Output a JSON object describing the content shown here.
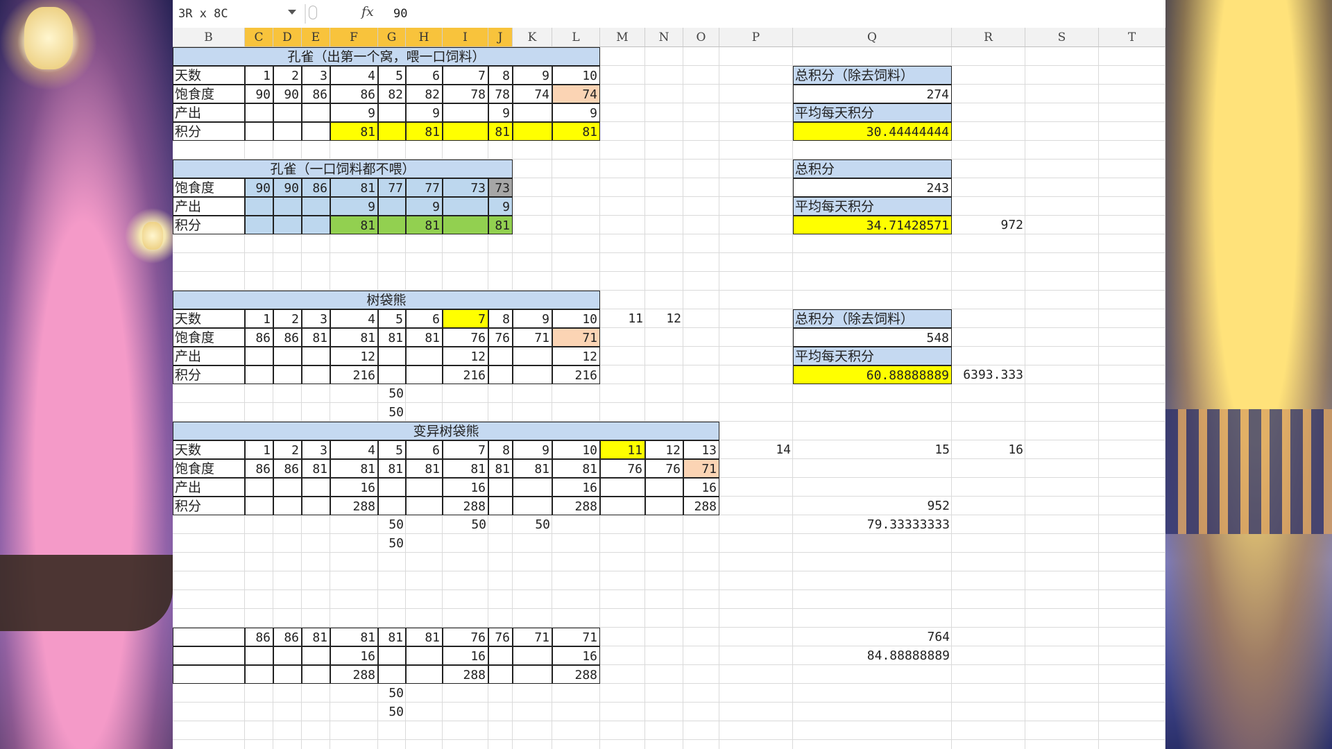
{
  "formula_bar": {
    "name_box": "3R x 8C",
    "fx_symbol": "fx",
    "value": "90"
  },
  "columns": [
    "B",
    "C",
    "D",
    "E",
    "F",
    "G",
    "H",
    "I",
    "J",
    "K",
    "L",
    "M",
    "N",
    "O",
    "P",
    "Q",
    "R",
    "S",
    "T"
  ],
  "selected_columns": [
    "C",
    "D",
    "E",
    "F",
    "G",
    "H",
    "I",
    "J"
  ],
  "peacock_fed": {
    "title": "孔雀（出第一个窝，喂一口饲料）",
    "labels": [
      "天数",
      "饱食度",
      "产出",
      "积分"
    ],
    "days": [
      "1",
      "2",
      "3",
      "4",
      "5",
      "6",
      "7",
      "8",
      "9",
      "10"
    ],
    "satiety": [
      "90",
      "90",
      "86",
      "86",
      "82",
      "82",
      "78",
      "78",
      "74",
      "74"
    ],
    "output": [
      "",
      "",
      "",
      "9",
      "",
      "9",
      "",
      "9",
      "",
      "9"
    ],
    "score": [
      "",
      "",
      "",
      "81",
      "",
      "81",
      "",
      "81",
      "",
      "81"
    ],
    "summary": {
      "total_label": "总积分（除去饲料）",
      "total": "274",
      "avg_label": "平均每天积分",
      "avg": "30.44444444"
    }
  },
  "peacock_unfed": {
    "title": "孔雀（一口饲料都不喂）",
    "labels": [
      "饱食度",
      "产出",
      "积分"
    ],
    "satiety": [
      "90",
      "90",
      "86",
      "81",
      "77",
      "77",
      "73",
      "73"
    ],
    "output": [
      "",
      "",
      "",
      "9",
      "",
      "9",
      "",
      "9"
    ],
    "score": [
      "",
      "",
      "",
      "81",
      "",
      "81",
      "",
      "81"
    ],
    "summary": {
      "total_label": "总积分",
      "total": "243",
      "avg_label": "平均每天积分",
      "avg": "34.71428571",
      "extra": "972"
    }
  },
  "koala": {
    "title": "树袋熊",
    "labels": [
      "天数",
      "饱食度",
      "产出",
      "积分"
    ],
    "days": [
      "1",
      "2",
      "3",
      "4",
      "5",
      "6",
      "7",
      "8",
      "9",
      "10",
      "11",
      "12"
    ],
    "satiety": [
      "86",
      "86",
      "81",
      "81",
      "81",
      "81",
      "76",
      "76",
      "71",
      "71"
    ],
    "output": [
      "",
      "",
      "",
      "12",
      "",
      "",
      "12",
      "",
      "",
      "12"
    ],
    "score": [
      "",
      "",
      "",
      "216",
      "",
      "",
      "216",
      "",
      "",
      "216"
    ],
    "feed": [
      "50",
      "50"
    ],
    "summary": {
      "total_label": "总积分（除去饲料）",
      "total": "548",
      "avg_label": "平均每天积分",
      "avg": "60.88888889",
      "extra": "6393.333"
    }
  },
  "mutant_koala": {
    "title": "变异树袋熊",
    "labels": [
      "天数",
      "饱食度",
      "产出",
      "积分"
    ],
    "days": [
      "1",
      "2",
      "3",
      "4",
      "5",
      "6",
      "7",
      "8",
      "9",
      "10",
      "11",
      "12",
      "13",
      "14",
      "15",
      "16"
    ],
    "satiety": [
      "86",
      "86",
      "81",
      "81",
      "81",
      "81",
      "81",
      "81",
      "81",
      "81",
      "76",
      "76",
      "71"
    ],
    "output": [
      "",
      "",
      "",
      "16",
      "",
      "",
      "16",
      "",
      "",
      "16",
      "",
      "",
      "16"
    ],
    "score": [
      "",
      "",
      "",
      "288",
      "",
      "",
      "288",
      "",
      "",
      "288",
      "",
      "",
      "288"
    ],
    "feed": [
      "50",
      "50",
      "50"
    ],
    "feed2": "50",
    "summary": {
      "total": "952",
      "avg": "79.33333333"
    }
  },
  "extra_table": {
    "satiety": [
      "86",
      "86",
      "81",
      "81",
      "81",
      "81",
      "76",
      "76",
      "71",
      "71"
    ],
    "output": [
      "",
      "",
      "",
      "16",
      "",
      "",
      "16",
      "",
      "",
      "16"
    ],
    "score": [
      "",
      "",
      "",
      "288",
      "",
      "",
      "288",
      "",
      "",
      "288"
    ],
    "feed": [
      "50",
      "50"
    ],
    "summary": {
      "total": "764",
      "avg": "84.88888889"
    }
  },
  "colors": {
    "yellow": "#ffff00",
    "orange": "#fbd4b4",
    "green": "#92d050",
    "blue": "#bdd7ee",
    "header_blue": "#c5d9f1",
    "selected_header": "#f8c33c"
  }
}
